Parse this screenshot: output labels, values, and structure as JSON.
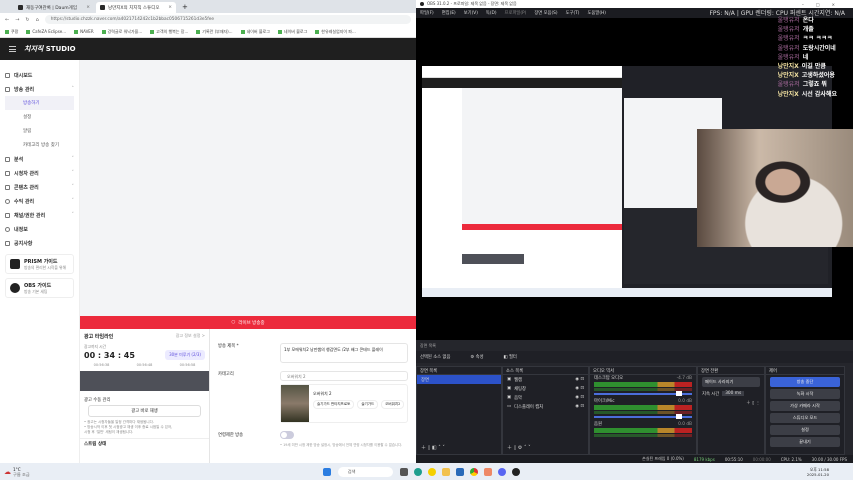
{
  "browser": {
    "tabs": [
      {
        "label": "재동구여관록 | Daum게임"
      },
      {
        "label": "낭만지X의 치지직 스튜디오"
      }
    ],
    "url": "https://studio.chzzk.naver.com/a4021714242c1b2bbac0506715261d3e5fee",
    "bookmarks": [
      "쿠팡",
      "CafeZA Eclipse...",
      "NAVER",
      "강력글로 워낙가을...",
      "고객의 행복는 장...",
      "기록란 (부재자)...",
      "네이버 블로그",
      "네이버 블로그",
      "한유레실업지이 파..."
    ],
    "studio": {
      "logo": "치지직",
      "logo_suffix": "STUDIO"
    },
    "sidebar": {
      "items": [
        {
          "label": "대시보드"
        },
        {
          "label": "방송 관리",
          "expanded": true
        },
        {
          "label": "분석"
        },
        {
          "label": "시청자 관리"
        },
        {
          "label": "콘텐츠 관리"
        },
        {
          "label": "수익 관리"
        },
        {
          "label": "채널/권한 관리"
        },
        {
          "label": "내정보"
        },
        {
          "label": "공지사항"
        }
      ],
      "sub_items": [
        {
          "label": "방송하기",
          "active": true
        },
        {
          "label": "설정"
        },
        {
          "label": "알림"
        },
        {
          "label": "카테고리 방송 찾기"
        }
      ],
      "guides": [
        {
          "title": "PRISM 가이드",
          "sub": "방송의 편리한 시작을 위해"
        },
        {
          "title": "OBS 가이드",
          "sub": "방송 기본 세팅"
        }
      ]
    },
    "live_bar": "라이브 방송중",
    "ad_panel": {
      "title": "광고 타임라인",
      "link": "광고 정보 설정 >",
      "next_label": "광고까지 시간",
      "timer": "00 : 34 : 45",
      "skip_btn": "30분 미루기 (2/3)",
      "ticks": [
        "00:56:38",
        "00:56:48",
        "00:56:58"
      ],
      "manual_title": "광고 수동 관리",
      "manual_btn": "광고 바로 재생",
      "notes": [
        "• 광고는 시청자들을 일정 간격마다 재생됩니다.",
        "• 방송시작 이후 첫 시점광고 재생 이후 종료 시점일 수 있어,",
        "  시청 후 '일반' 세팅이 재생됩니다."
      ],
      "next_section": "스트림 상태"
    },
    "form": {
      "title_label": "방송 제목 *",
      "title_value": "1부 모에워치2 낭만쌤의 챙갑면도 /2부 배그 콘테드 플레이",
      "category_label": "카테고리",
      "category_value": "오버워치 2",
      "game_name": "오버워치 2",
      "tags": [
        "슬기가드 판타지프로토",
        "슬기가드",
        "오버워치2"
      ],
      "adult_label": "연령제한 방송",
      "adult_on": false,
      "adult_note": "• 19세 미만 시청 제한 방송 설정시, 방송에서 전체 연령 시청자를 이용할 수 없습니다."
    }
  },
  "obs": {
    "title": "OBS 31.0.2 - 프로파일: 제목 없음 - 장면: 제목 없음",
    "menu": [
      "파일(F)",
      "편집(E)",
      "보기(V)",
      "독(D)",
      "프로파일(P)",
      "장면 모음(S)",
      "도구(T)",
      "도움말(H)"
    ],
    "stats": "FPS: N/A  |  GPU 렌더링: CPU 퍼센트  시간지연: N/A",
    "chat": [
      {
        "name": "울탱유저",
        "msg": "온다"
      },
      {
        "name": "울탱유저",
        "msg": "개졸"
      },
      {
        "name": "울탱유저",
        "msg": "ㅋㅋ ㅋㅋㅋ"
      },
      {
        "name": "울탱유저",
        "msg": "도랑시간이네"
      },
      {
        "name": "울탱유저",
        "msg": "네"
      },
      {
        "name": "낭만지X",
        "msg": "이길 만큼"
      },
      {
        "name": "낭만지X",
        "msg": "고생하셨어용"
      },
      {
        "name": "울탱유저",
        "msg": "그렇죠 뭐"
      },
      {
        "name": "낭만지X",
        "msg": "시선 감사해요"
      }
    ],
    "scene_selector": "장면 목록",
    "no_source": "선택된 소스 없음",
    "props_btn": "속성",
    "filter_btn": "필터",
    "docks": {
      "scenes": {
        "title": "장면 목록",
        "items": [
          "장면"
        ]
      },
      "sources": {
        "title": "소스 목록",
        "items": [
          "웹캠",
          "채팅창",
          "음악",
          "디스플레이 캡처"
        ]
      },
      "mixer": {
        "title": "오디오 믹서",
        "channels": [
          {
            "name": "데스크탑 오디오",
            "db": "-4.7 dB"
          },
          {
            "name": "마이크/Mic",
            "db": "0.0 dB"
          },
          {
            "name": "음원",
            "db": "0.0 dB"
          }
        ]
      },
      "transitions": {
        "title": "장면 전환",
        "type": "페이드 사라지기",
        "duration_label": "지속 시간",
        "duration": "300 ms"
      },
      "controls": {
        "title": "제어",
        "buttons": [
          "방송 중단",
          "녹화 시작",
          "가상 카메라 시작",
          "스튜디오 모드",
          "설정",
          "끝내기"
        ]
      }
    },
    "status": {
      "dropped": "손실된 프레임 0 (0.0%)",
      "bitrate": "8179 kbps",
      "live_time": "00:55:10",
      "rec_time": "00:00:00",
      "cpu": "CPU: 2.1%",
      "fps": "30.00 / 30.00 FPS"
    }
  },
  "taskbar": {
    "weather_temp": "1°C",
    "weather_desc": "구름 조금",
    "search": "검색",
    "time": "오후 11:58",
    "date": "2025-01-20"
  }
}
